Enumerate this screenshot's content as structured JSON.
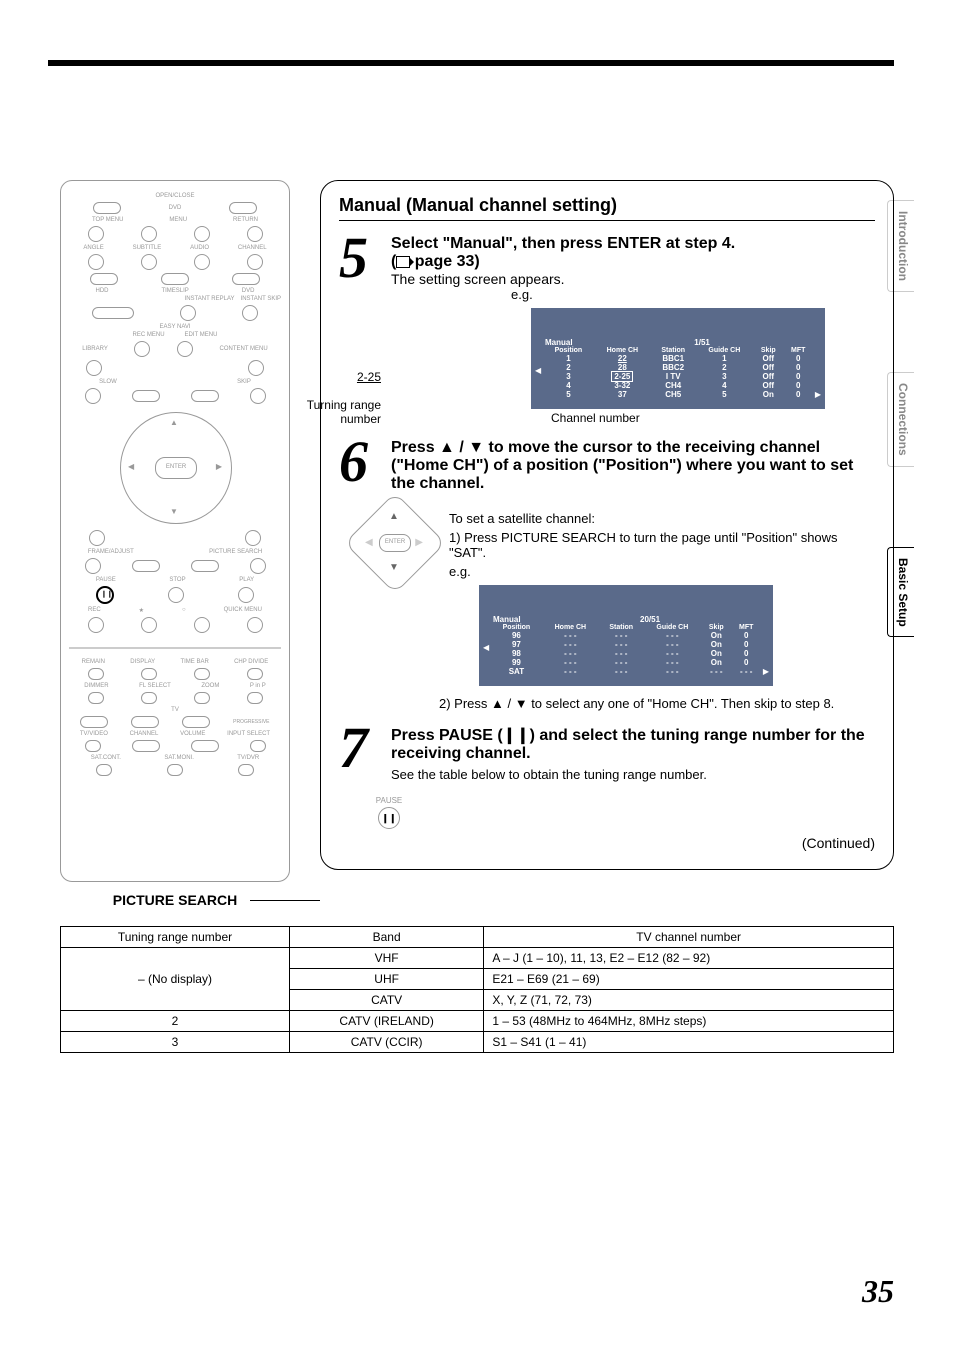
{
  "page_number": "35",
  "tabs": {
    "t1": "Introduction",
    "t2": "Connections",
    "t3": "Basic Setup"
  },
  "remote": {
    "enter": "ENTER",
    "pause": "PAUSE",
    "stop": "STOP",
    "play": "PLAY",
    "rec": "REC",
    "quick": "QUICK MENU",
    "picture_search": "PICTURE SEARCH",
    "labels": {
      "open": "OPEN/CLOSE",
      "dvd": "DVD",
      "top": "TOP MENU",
      "menu": "MENU",
      "ret": "RETURN",
      "angle": "ANGLE",
      "sub": "SUBTITLE",
      "audio": "AUDIO",
      "chan": "CHANNEL",
      "hdd": "HDD",
      "timeslip": "TIMESLIP",
      "dvd2": "DVD",
      "instr": "INSTANT REPLAY",
      "insts": "INSTANT SKIP",
      "easy": "EASY NAVI",
      "recm": "REC MENU",
      "editm": "EDIT MENU",
      "lib": "LIBRARY",
      "cont": "CONTENT MENU",
      "slow": "SLOW",
      "skip": "SKIP",
      "frame": "FRAME/ADJUST",
      "pics": "PICTURE SEARCH",
      "remain": "REMAIN",
      "disp": "DISPLAY",
      "tbar": "TIME BAR",
      "chpd": "CHP DIVIDE",
      "dim": "DIMMER",
      "flsel": "FL SELECT",
      "zoom": "ZOOM",
      "pinp": "P in P",
      "tv": "TV",
      "prog": "PROGRESSIVE",
      "tvvid": "TV/VIDEO",
      "chan2": "CHANNEL",
      "vol": "VOLUME",
      "inpsel": "INPUT SELECT",
      "satc": "SAT.CONT.",
      "satm": "SAT.MONI.",
      "tvdvr": "TV/DVR"
    }
  },
  "panel": {
    "title": "Manual (Manual channel setting)",
    "step5": {
      "head": "Select \"Manual\", then press ENTER at step 4.",
      "ref": "page 33",
      "sub": "The setting screen appears.",
      "eg": "e.g.",
      "turning_range_caption": "2-25",
      "turning_range_label": "Turning range number",
      "channel_number_label": "Channel number",
      "osd_title": "Manual",
      "osd_count": "1/51",
      "osd_headers": [
        "Position",
        "Home CH",
        "Station",
        "Guide CH",
        "Skip",
        "MFT"
      ],
      "osd_rows": [
        [
          "1",
          "22",
          "BBC1",
          "1",
          "Off",
          "0"
        ],
        [
          "2",
          "28",
          "BBC2",
          "2",
          "Off",
          "0"
        ],
        [
          "3",
          "2-25",
          "I TV",
          "3",
          "Off",
          "0"
        ],
        [
          "4",
          "3-32",
          "CH4",
          "4",
          "Off",
          "0"
        ],
        [
          "5",
          "37",
          "CH5",
          "5",
          "On",
          "0"
        ]
      ]
    },
    "step6": {
      "head": "Press ▲ / ▼ to move the cursor to the receiving channel (\"Home CH\") of a position (\"Position\") where you want to set the channel.",
      "sat_intro": "To set a satellite channel:",
      "sat_1": "1) Press PICTURE SEARCH to turn the page until \"Position\" shows \"SAT\".",
      "eg": "e.g.",
      "osd_title": "Manual",
      "osd_count": "20/51",
      "osd_headers": [
        "Position",
        "Home CH",
        "Station",
        "Guide CH",
        "Skip",
        "MFT"
      ],
      "osd_rows": [
        [
          "96",
          "- - -",
          "- - -",
          "- - -",
          "On",
          "0"
        ],
        [
          "97",
          "- - -",
          "- - -",
          "- - -",
          "On",
          "0"
        ],
        [
          "98",
          "- - -",
          "- - -",
          "- - -",
          "On",
          "0"
        ],
        [
          "99",
          "- - -",
          "- - -",
          "- - -",
          "On",
          "0"
        ],
        [
          "SAT",
          "- - -",
          "- - -",
          "- - -",
          "- - -",
          "- - -"
        ]
      ],
      "sat_2": "2) Press ▲ / ▼ to select any one of \"Home CH\". Then skip to step 8."
    },
    "step7": {
      "head": "Press PAUSE (❙❙) and select the tuning range number for the receiving channel.",
      "sub": "See the table below to obtain the tuning range number.",
      "pause": "PAUSE"
    },
    "continued": "(Continued)"
  },
  "table": {
    "h1": "Tuning range number",
    "h2": "Band",
    "h3": "TV channel number",
    "r1c1": "– (No display)",
    "r1": [
      [
        "VHF",
        "A – J (1 – 10), 11, 13, E2 – E12 (82 – 92)"
      ],
      [
        "UHF",
        "E21 – E69 (21 – 69)"
      ],
      [
        "CATV",
        "X, Y, Z (71, 72, 73)"
      ]
    ],
    "r2": [
      "2",
      "CATV (IRELAND)",
      "1 – 53 (48MHz to 464MHz, 8MHz steps)"
    ],
    "r3": [
      "3",
      "CATV (CCIR)",
      "S1 – S41 (1 – 41)"
    ]
  }
}
